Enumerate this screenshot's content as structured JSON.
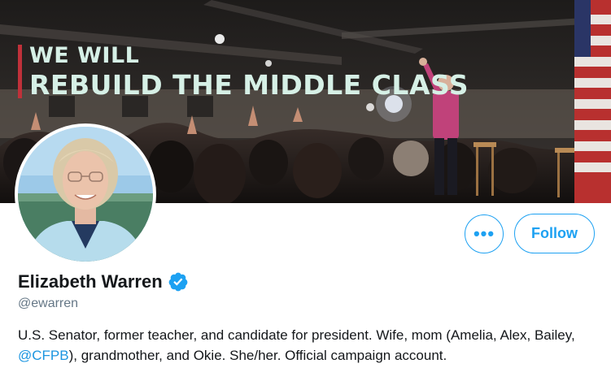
{
  "banner": {
    "headline_line1": "WE WILL",
    "headline_line2": "REBUILD THE MIDDLE CLASS"
  },
  "actions": {
    "more_label": "•••",
    "follow_label": "Follow"
  },
  "profile": {
    "name": "Elizabeth Warren",
    "handle": "@ewarren",
    "bio_part1": "U.S. Senator, former teacher, and candidate for president. Wife, mom (Amelia, Alex, Bailey, ",
    "bio_mention": "@CFPB",
    "bio_part2": "), grandmother, and Okie. She/her. Official campaign account."
  },
  "colors": {
    "accent": "#1da1f2",
    "link": "#1b95e0",
    "text": "#14171a",
    "muted": "#657786",
    "headline": "#d6f0e6",
    "headline_bar": "#c0313a"
  },
  "icons": {
    "verified": "verified-badge-icon",
    "more": "more-horizontal-icon"
  }
}
